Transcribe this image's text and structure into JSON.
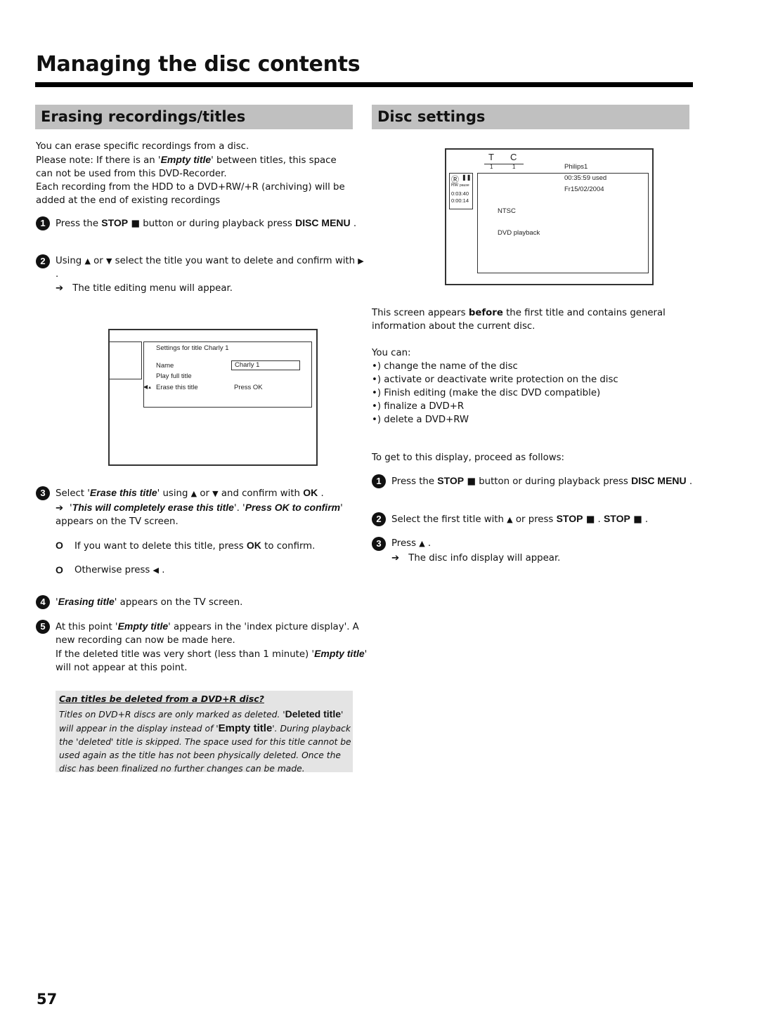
{
  "page": {
    "title": "Managing the disc contents",
    "page_number": "57"
  },
  "left": {
    "heading": "Erasing recordings/titles",
    "intro": [
      "You can erase specific recordings from a disc.",
      "Please note: If there is an '",
      "Empty title",
      "' between titles, this space can not be used from this DVD-Recorder.",
      "Each recording from the HDD to a DVD+RW/+R (archiving) will be added at the end of existing recordings"
    ],
    "steps": [
      {
        "num": "1",
        "pre": "Press the ",
        "stop": "STOP",
        "mid": " button or during playback press ",
        "key": "DISC MENU",
        "post": " ."
      },
      {
        "num": "2",
        "pre": "Using ",
        "mid1": " or ",
        "mid2": " select the title you want to delete and confirm with ",
        "post": " .",
        "result": "The title editing menu will appear."
      },
      {
        "num": "3",
        "pre": "Select '",
        "em": "Erase this title",
        "mid1": "' using ",
        "mid2": " or ",
        "mid3": " and confirm with ",
        "key": "OK",
        "post": " .",
        "result_q1": "'",
        "result_em1": "This will completely erase this title",
        "result_q2": "'. '",
        "result_em2": "Press OK to confirm",
        "result_post": "' appears on the TV screen.",
        "options": [
          {
            "pre": "If you want to delete this title, press ",
            "key": "OK",
            "post": " to confirm."
          },
          {
            "pre": "Otherwise press ",
            "post": " ."
          }
        ]
      },
      {
        "num": "4",
        "q1": "'",
        "em": "Erasing title",
        "post": "' appears on the TV screen."
      },
      {
        "num": "5",
        "pre": "At this point '",
        "em": "Empty title",
        "post": "' appears in the 'index picture display'. A new recording can now be made here.",
        "pre2": "If the deleted title was very short (less than 1 minute) '",
        "em2": "Empty title",
        "post2": "' will not appear at this point."
      }
    ],
    "osd": {
      "title": "Settings for title Charly 1",
      "rows": [
        {
          "label": "Name",
          "value": "Charly 1"
        },
        {
          "label": "Play full title",
          "value": ""
        },
        {
          "label": "Erase this title",
          "value": "Press OK"
        }
      ]
    },
    "note": {
      "title": "Can titles be deleted from a DVD+R disc?",
      "body_1": "Titles on DVD+R discs are only marked as deleted. '",
      "em_1": "Deleted title",
      "body_2": "' will appear in the display instead of '",
      "em_2": "Empty title",
      "body_3": "'. During playback the 'deleted' title is skipped. The space used for this title cannot be used again as the title has not been physically deleted. Once the disc has been finalized no further changes can be made."
    }
  },
  "right": {
    "heading": "Disc settings",
    "osd": {
      "t_label": "T",
      "c_label": "C",
      "t_value": "1",
      "c_value": "1",
      "disc_name": "Philips1",
      "used": "00:35:59 used",
      "date": "Fr15/02/2004",
      "system": "NTSC",
      "mode": "DVD playback",
      "status_disc": "RW",
      "status_state": "pause",
      "time_total": "0:03:40",
      "time_elapsed": "0:00:14"
    },
    "intro_pre": "This screen appears ",
    "intro_bold": "before",
    "intro_post": " the first title and contains general information about the current disc.",
    "you_can": "You can:",
    "bullets": [
      "•) change the name of the disc",
      "•) activate or deactivate write protection on the disc",
      "•) Finish editing (make the disc DVD compatible)",
      "•) finalize a DVD+R",
      "•) delete a DVD+RW"
    ],
    "proceed": "To get to this display, proceed as follows:",
    "steps": [
      {
        "num": "1",
        "pre": "Press the ",
        "stop": "STOP",
        "mid": " button or during playback press ",
        "key": "DISC MENU",
        "post": " ."
      },
      {
        "num": "2",
        "pre": "Select the first title with ",
        "mid": " or press ",
        "stop1": "STOP",
        "sep": " . ",
        "stop2": "STOP",
        "post": " ."
      },
      {
        "num": "3",
        "pre": "Press ",
        "post": " .",
        "result": "The disc info display will appear."
      }
    ]
  },
  "icons": {
    "stop": "■",
    "up": "▲",
    "down": "▼",
    "right": "▶",
    "left": "◀",
    "arrow": "➔",
    "bullet_o": "O"
  }
}
